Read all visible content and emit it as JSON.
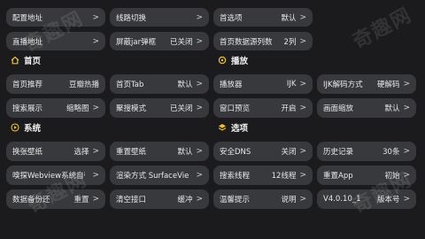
{
  "rows_top": [
    [
      {
        "label": "配置地址",
        "value": ""
      },
      {
        "label": "线路切换",
        "value": ""
      },
      {
        "label": "首选项",
        "value": "默认"
      }
    ],
    [
      {
        "label": "直播地址",
        "value": ""
      },
      {
        "label": "屏蔽jar弹框",
        "value": "已关闭"
      },
      {
        "label": "首页数据源列数",
        "value": "2列"
      }
    ]
  ],
  "section_home": {
    "title": "首页",
    "icon": "home-icon"
  },
  "section_play": {
    "title": "播放",
    "icon": "play-circle-icon"
  },
  "rows_mid": [
    [
      {
        "label": "首页推荐",
        "value": "豆瓣热播"
      },
      {
        "label": "首页Tab",
        "value": "默认"
      },
      {
        "label": "播放器",
        "value": "IJK"
      },
      {
        "label": "IJK解码方式",
        "value": "硬解码"
      }
    ],
    [
      {
        "label": "搜索展示",
        "value": "缩略图"
      },
      {
        "label": "聚搜模式",
        "value": "已关闭"
      },
      {
        "label": "窗口预览",
        "value": "开启"
      },
      {
        "label": "画面缩放",
        "value": "默认"
      }
    ]
  ],
  "section_system": {
    "title": "系统",
    "icon": "play-circle-icon"
  },
  "section_options": {
    "title": "选项",
    "icon": "layers-icon"
  },
  "rows_bottom": [
    [
      {
        "label": "换张壁纸",
        "value": "选择"
      },
      {
        "label": "重置壁纸",
        "value": "默认"
      },
      {
        "label": "安全DNS",
        "value": "关闭"
      },
      {
        "label": "历史记录",
        "value": "30条"
      }
    ],
    [
      {
        "label": "嗅探Webview系统自带",
        "value": ""
      },
      {
        "label": "渲染方式 SurfaceView",
        "value": ""
      },
      {
        "label": "搜索线程",
        "value": "12线程"
      },
      {
        "label": "重置App",
        "value": "初始"
      }
    ],
    [
      {
        "label": "数据备份还",
        "value": "重置"
      },
      {
        "label": "清空接口",
        "value": "缓冲"
      },
      {
        "label": "温馨提示",
        "value": "说明"
      },
      {
        "label": "V4.0.10_1",
        "value": "版本号"
      }
    ]
  ],
  "watermark": "奇趣网",
  "chevron": ">"
}
